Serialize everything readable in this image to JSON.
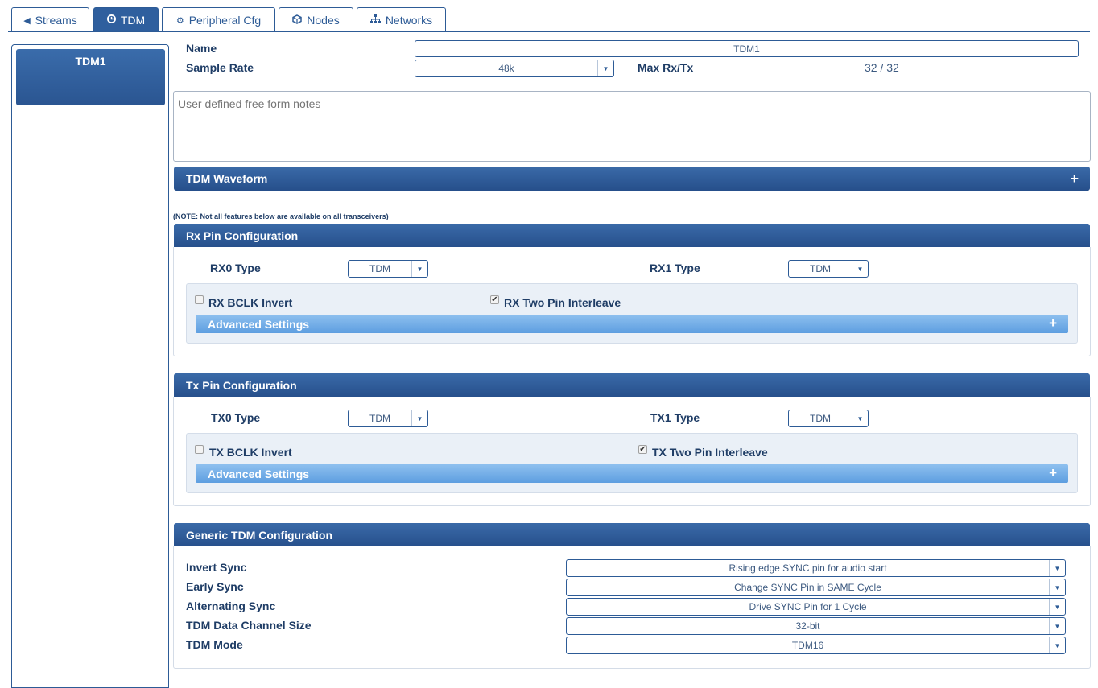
{
  "tabs": [
    {
      "label": "Streams",
      "icon": "left-arrow-icon"
    },
    {
      "label": "TDM",
      "icon": "clock-icon"
    },
    {
      "label": "Peripheral Cfg",
      "icon": "gear-icon"
    },
    {
      "label": "Nodes",
      "icon": "cube-icon"
    },
    {
      "label": "Networks",
      "icon": "network-icon"
    }
  ],
  "active_tab": "TDM",
  "sidebar": {
    "items": [
      {
        "label": "TDM1"
      }
    ]
  },
  "form": {
    "name_label": "Name",
    "name_value": "TDM1",
    "sample_rate_label": "Sample Rate",
    "sample_rate_value": "48k",
    "max_rxtx_label": "Max Rx/Tx",
    "max_rxtx_value": "32 / 32",
    "notes_placeholder": "User defined free form notes"
  },
  "waveform": {
    "title": "TDM Waveform"
  },
  "note_text": "(NOTE: Not all features below are available on all transceivers)",
  "rx": {
    "title": "Rx Pin Configuration",
    "rx0_label": "RX0 Type",
    "rx0_value": "TDM",
    "rx1_label": "RX1 Type",
    "rx1_value": "TDM",
    "bclk_invert_label": "RX BCLK Invert",
    "bclk_invert_checked": false,
    "two_pin_label": "RX Two Pin Interleave",
    "two_pin_checked": true,
    "advanced_label": "Advanced Settings"
  },
  "tx": {
    "title": "Tx Pin Configuration",
    "tx0_label": "TX0 Type",
    "tx0_value": "TDM",
    "tx1_label": "TX1 Type",
    "tx1_value": "TDM",
    "bclk_invert_label": "TX BCLK Invert",
    "bclk_invert_checked": false,
    "two_pin_label": "TX Two Pin Interleave",
    "two_pin_checked": true,
    "advanced_label": "Advanced Settings"
  },
  "generic": {
    "title": "Generic TDM Configuration",
    "rows": [
      {
        "label": "Invert Sync",
        "value": "Rising edge SYNC pin for audio start"
      },
      {
        "label": "Early Sync",
        "value": "Change SYNC Pin in SAME Cycle"
      },
      {
        "label": "Alternating Sync",
        "value": "Drive SYNC Pin for 1 Cycle"
      },
      {
        "label": "TDM Data Channel Size",
        "value": "32-bit"
      },
      {
        "label": "TDM Mode",
        "value": "TDM16"
      }
    ]
  },
  "colors": {
    "primary": "#2f5f9e",
    "panel_header": "#264f8b",
    "advanced_bar": "#5d9ee0",
    "label_text": "#1f3d66"
  }
}
